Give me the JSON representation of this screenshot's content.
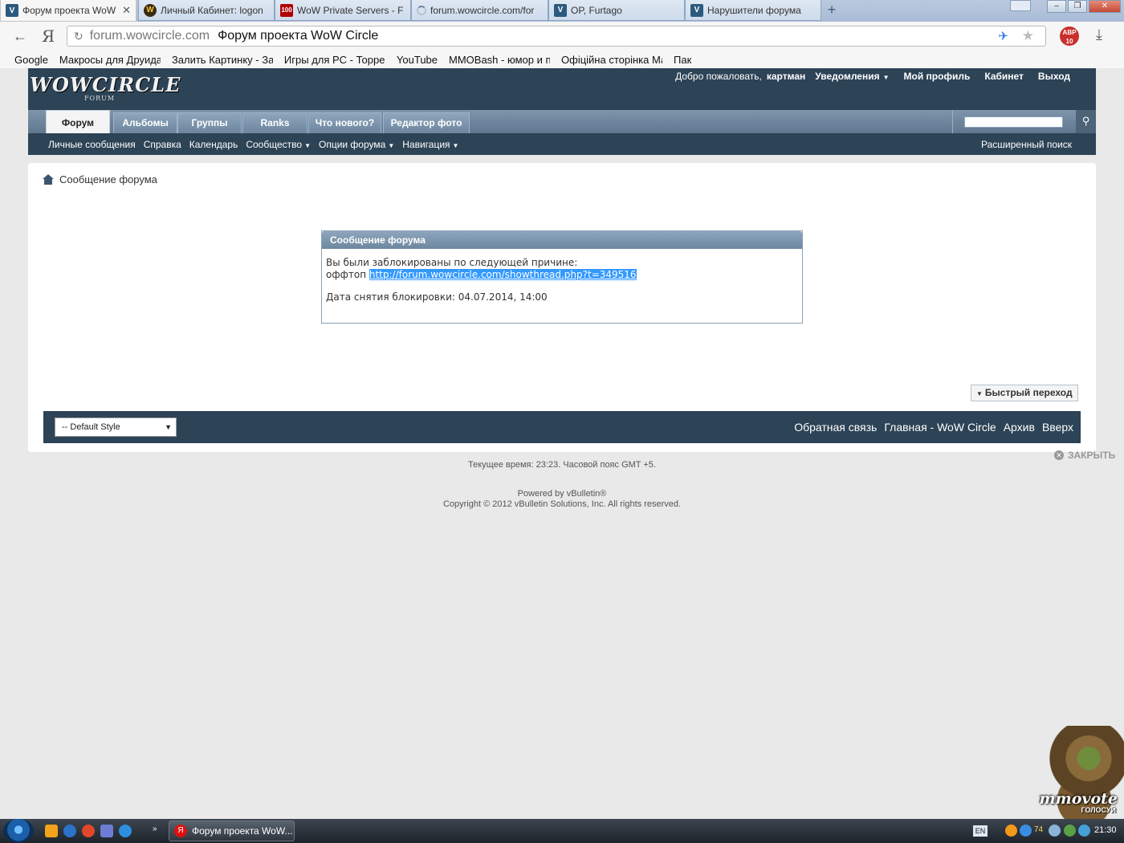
{
  "browser": {
    "tabs": [
      {
        "label": "Форум проекта WoW Ci",
        "icon": "vbulletin-icon",
        "active": true,
        "close": "✕"
      },
      {
        "label": "Личный Кабинет: logon",
        "icon": "wow-icon",
        "active": false
      },
      {
        "label": "WoW Private Servers - F",
        "icon": "top100-icon",
        "active": false
      },
      {
        "label": "forum.wowcircle.com/for",
        "icon": "loading-icon",
        "active": false
      },
      {
        "label": "OP, Furtago",
        "icon": "vbulletin-icon",
        "active": false
      },
      {
        "label": "Нарушители форума",
        "icon": "vbulletin-icon",
        "active": false
      }
    ],
    "new_tab": "+",
    "address": {
      "domain": "forum.wowcircle.com",
      "title": "Форум проекта WoW Circle"
    },
    "yandex_btn": "Я",
    "adblock_badge": "ABP 10",
    "bookmarks": [
      "Google",
      "Макросы для Друида",
      "Залить Картинку - За",
      "Игры для PC - Торрен",
      "YouTube",
      "MMOBash - юмор и пр",
      "Офіційна сторінка Ма",
      "Пак"
    ]
  },
  "header": {
    "logo": "WOWCIRCLE",
    "logo_sub": "FORUM",
    "welcome": "Добро пожаловать,",
    "username": "картман",
    "notifications": "Уведомления",
    "profile": "Мой профиль",
    "cabinet": "Кабинет",
    "logout": "Выход"
  },
  "nav": {
    "tabs": [
      "Форум",
      "Альбомы",
      "Группы",
      "Ranks",
      "Что нового?",
      "Редактор фото"
    ],
    "active_tab": "Форум"
  },
  "subnav": {
    "items": [
      "Личные сообщения",
      "Справка",
      "Календарь"
    ],
    "dropdowns": [
      "Сообщество",
      "Опции форума",
      "Навигация"
    ],
    "advanced_search": "Расширенный поиск"
  },
  "breadcrumb": "Сообщение форума",
  "message": {
    "title": "Сообщение форума",
    "line1": "Вы были заблокированы по следующей причине:",
    "reason": "оффтоп",
    "link": "http://forum.wowcircle.com/showthread.php?t=349516",
    "unblock": "Дата снятия блокировки: 04.07.2014, 14:00"
  },
  "quick_nav": "Быстрый переход",
  "footer": {
    "style_select": "-- Default Style",
    "links": [
      "Обратная связь",
      "Главная - WoW Circle",
      "Архив",
      "Вверх"
    ]
  },
  "close_ads": "ЗАКРЫТЬ",
  "time_line": "Текущее время: 23:23. Часовой пояс GMT +5.",
  "powered": "Powered by vBulletin®",
  "copyright": "Copyright © 2012 vBulletin Solutions, Inc. All rights reserved.",
  "vote_widget": {
    "text": "mmovote",
    "sub": "ГОЛОСУЙ"
  },
  "taskbar": {
    "window_label": "Форум проекта WoW...",
    "lang": "EN",
    "temperature": "74",
    "clock": "21:30"
  },
  "colors": {
    "header_bg": "#2d4356",
    "nav_bg": "#6d879f",
    "selection": "#3399ff",
    "page_bg": "#e9e9e9"
  }
}
